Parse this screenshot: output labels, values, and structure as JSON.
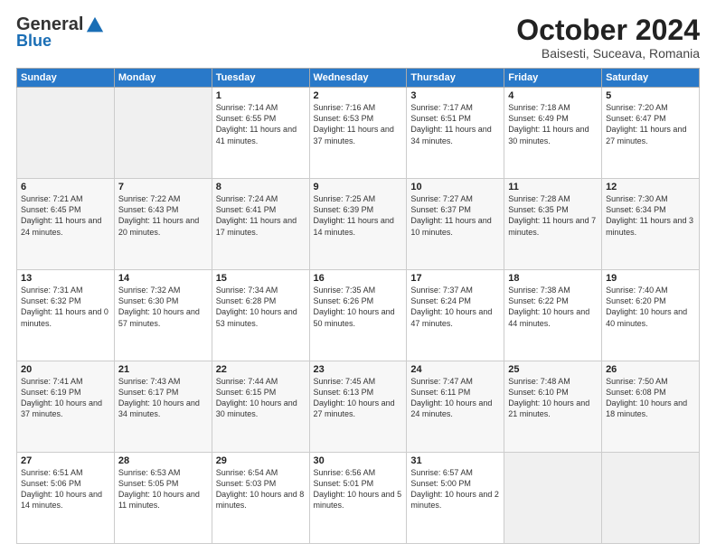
{
  "header": {
    "logo_general": "General",
    "logo_blue": "Blue",
    "month": "October 2024",
    "location": "Baisesti, Suceava, Romania"
  },
  "weekdays": [
    "Sunday",
    "Monday",
    "Tuesday",
    "Wednesday",
    "Thursday",
    "Friday",
    "Saturday"
  ],
  "rows": [
    [
      {
        "day": "",
        "content": ""
      },
      {
        "day": "",
        "content": ""
      },
      {
        "day": "1",
        "content": "Sunrise: 7:14 AM\nSunset: 6:55 PM\nDaylight: 11 hours and 41 minutes."
      },
      {
        "day": "2",
        "content": "Sunrise: 7:16 AM\nSunset: 6:53 PM\nDaylight: 11 hours and 37 minutes."
      },
      {
        "day": "3",
        "content": "Sunrise: 7:17 AM\nSunset: 6:51 PM\nDaylight: 11 hours and 34 minutes."
      },
      {
        "day": "4",
        "content": "Sunrise: 7:18 AM\nSunset: 6:49 PM\nDaylight: 11 hours and 30 minutes."
      },
      {
        "day": "5",
        "content": "Sunrise: 7:20 AM\nSunset: 6:47 PM\nDaylight: 11 hours and 27 minutes."
      }
    ],
    [
      {
        "day": "6",
        "content": "Sunrise: 7:21 AM\nSunset: 6:45 PM\nDaylight: 11 hours and 24 minutes."
      },
      {
        "day": "7",
        "content": "Sunrise: 7:22 AM\nSunset: 6:43 PM\nDaylight: 11 hours and 20 minutes."
      },
      {
        "day": "8",
        "content": "Sunrise: 7:24 AM\nSunset: 6:41 PM\nDaylight: 11 hours and 17 minutes."
      },
      {
        "day": "9",
        "content": "Sunrise: 7:25 AM\nSunset: 6:39 PM\nDaylight: 11 hours and 14 minutes."
      },
      {
        "day": "10",
        "content": "Sunrise: 7:27 AM\nSunset: 6:37 PM\nDaylight: 11 hours and 10 minutes."
      },
      {
        "day": "11",
        "content": "Sunrise: 7:28 AM\nSunset: 6:35 PM\nDaylight: 11 hours and 7 minutes."
      },
      {
        "day": "12",
        "content": "Sunrise: 7:30 AM\nSunset: 6:34 PM\nDaylight: 11 hours and 3 minutes."
      }
    ],
    [
      {
        "day": "13",
        "content": "Sunrise: 7:31 AM\nSunset: 6:32 PM\nDaylight: 11 hours and 0 minutes."
      },
      {
        "day": "14",
        "content": "Sunrise: 7:32 AM\nSunset: 6:30 PM\nDaylight: 10 hours and 57 minutes."
      },
      {
        "day": "15",
        "content": "Sunrise: 7:34 AM\nSunset: 6:28 PM\nDaylight: 10 hours and 53 minutes."
      },
      {
        "day": "16",
        "content": "Sunrise: 7:35 AM\nSunset: 6:26 PM\nDaylight: 10 hours and 50 minutes."
      },
      {
        "day": "17",
        "content": "Sunrise: 7:37 AM\nSunset: 6:24 PM\nDaylight: 10 hours and 47 minutes."
      },
      {
        "day": "18",
        "content": "Sunrise: 7:38 AM\nSunset: 6:22 PM\nDaylight: 10 hours and 44 minutes."
      },
      {
        "day": "19",
        "content": "Sunrise: 7:40 AM\nSunset: 6:20 PM\nDaylight: 10 hours and 40 minutes."
      }
    ],
    [
      {
        "day": "20",
        "content": "Sunrise: 7:41 AM\nSunset: 6:19 PM\nDaylight: 10 hours and 37 minutes."
      },
      {
        "day": "21",
        "content": "Sunrise: 7:43 AM\nSunset: 6:17 PM\nDaylight: 10 hours and 34 minutes."
      },
      {
        "day": "22",
        "content": "Sunrise: 7:44 AM\nSunset: 6:15 PM\nDaylight: 10 hours and 30 minutes."
      },
      {
        "day": "23",
        "content": "Sunrise: 7:45 AM\nSunset: 6:13 PM\nDaylight: 10 hours and 27 minutes."
      },
      {
        "day": "24",
        "content": "Sunrise: 7:47 AM\nSunset: 6:11 PM\nDaylight: 10 hours and 24 minutes."
      },
      {
        "day": "25",
        "content": "Sunrise: 7:48 AM\nSunset: 6:10 PM\nDaylight: 10 hours and 21 minutes."
      },
      {
        "day": "26",
        "content": "Sunrise: 7:50 AM\nSunset: 6:08 PM\nDaylight: 10 hours and 18 minutes."
      }
    ],
    [
      {
        "day": "27",
        "content": "Sunrise: 6:51 AM\nSunset: 5:06 PM\nDaylight: 10 hours and 14 minutes."
      },
      {
        "day": "28",
        "content": "Sunrise: 6:53 AM\nSunset: 5:05 PM\nDaylight: 10 hours and 11 minutes."
      },
      {
        "day": "29",
        "content": "Sunrise: 6:54 AM\nSunset: 5:03 PM\nDaylight: 10 hours and 8 minutes."
      },
      {
        "day": "30",
        "content": "Sunrise: 6:56 AM\nSunset: 5:01 PM\nDaylight: 10 hours and 5 minutes."
      },
      {
        "day": "31",
        "content": "Sunrise: 6:57 AM\nSunset: 5:00 PM\nDaylight: 10 hours and 2 minutes."
      },
      {
        "day": "",
        "content": ""
      },
      {
        "day": "",
        "content": ""
      }
    ]
  ]
}
